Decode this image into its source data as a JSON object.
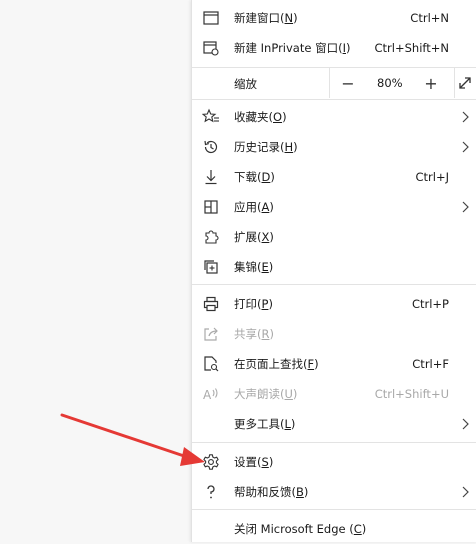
{
  "menu": {
    "new_window": {
      "label": "新建窗口(",
      "key": "N",
      "tail": ")",
      "shortcut": "Ctrl+N"
    },
    "new_private": {
      "label": "新建 InPrivate 窗口(",
      "key": "I",
      "tail": ")",
      "shortcut": "Ctrl+Shift+N"
    },
    "zoom": {
      "label": "缩放",
      "minus": "−",
      "value": "80%",
      "plus": "+"
    },
    "favorites": {
      "label": "收藏夹(",
      "key": "O",
      "tail": ")"
    },
    "history": {
      "label": "历史记录(",
      "key": "H",
      "tail": ")"
    },
    "downloads": {
      "label": "下载(",
      "key": "D",
      "tail": ")",
      "shortcut": "Ctrl+J"
    },
    "apps": {
      "label": "应用(",
      "key": "A",
      "tail": ")"
    },
    "extensions": {
      "label": "扩展(",
      "key": "X",
      "tail": ")"
    },
    "collections": {
      "label": "集锦(",
      "key": "E",
      "tail": ")"
    },
    "print": {
      "label": "打印(",
      "key": "P",
      "tail": ")",
      "shortcut": "Ctrl+P"
    },
    "share": {
      "label": "共享(",
      "key": "R",
      "tail": ")"
    },
    "find": {
      "label": "在页面上查找(",
      "key": "F",
      "tail": ")",
      "shortcut": "Ctrl+F"
    },
    "read_aloud": {
      "label": "大声朗读(",
      "key": "U",
      "tail": ")",
      "shortcut": "Ctrl+Shift+U"
    },
    "more_tools": {
      "label": "更多工具(",
      "key": "L",
      "tail": ")"
    },
    "settings": {
      "label": "设置(",
      "key": "S",
      "tail": ")"
    },
    "help": {
      "label": "帮助和反馈(",
      "key": "B",
      "tail": ")"
    },
    "close": {
      "label": "关闭 Microsoft Edge (",
      "key": "C",
      "tail": ")"
    }
  },
  "colors": {
    "arrow": "#e53935",
    "disabled_text": "#a8a8a8",
    "separator": "#e3e3e3"
  }
}
